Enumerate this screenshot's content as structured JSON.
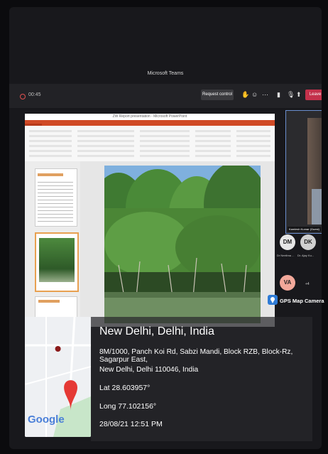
{
  "teams": {
    "window_title": "Microsoft Teams",
    "timer": "00:45",
    "request_control": "Request control",
    "leave": "Leave"
  },
  "powerpoint": {
    "title": "ZW Report presentation - Microsoft PowerPoint"
  },
  "participants": {
    "presenter_name": "Kamlesh Kumar (Guest)",
    "avatars": [
      {
        "initials": "DM",
        "label": "Dr Neelima ...",
        "color": "#e6e6e6"
      },
      {
        "initials": "DK",
        "label": "Dr. Ajay Ku...",
        "color": "#d0d0d0"
      },
      {
        "initials": "VA",
        "label": "",
        "color": "#f2a89a"
      }
    ],
    "more_count": "+4"
  },
  "gps": {
    "app_name": "GPS Map Camera",
    "place": "New Delhi, Delhi, India",
    "address_line1": "8M/1000, Panch Koi Rd, Sabzi Mandi, Block RZB, Block-Rz, Sagarpur East,",
    "address_line2": "New Delhi, Delhi 110046, India",
    "lat": "Lat 28.603957°",
    "long": "Long 77.102156°",
    "datetime": "28/08/21 12:51 PM",
    "map_logo": "Google"
  },
  "colors": {
    "leave_red": "#c4314b",
    "ppt_orange": "#d04a26",
    "pin_red": "#e53935"
  }
}
